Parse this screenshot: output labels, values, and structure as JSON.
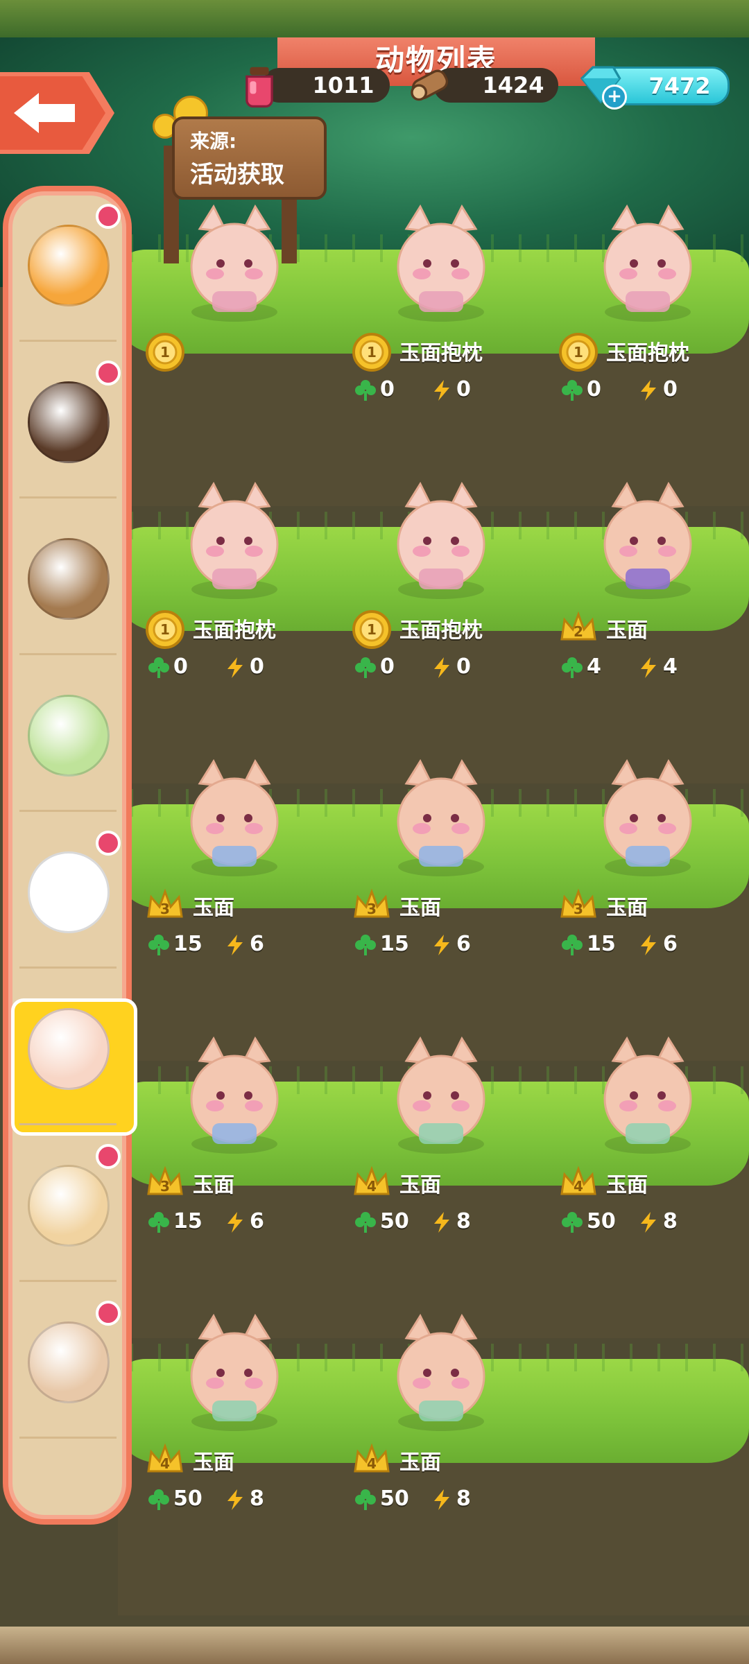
{
  "header": {
    "title": "动物列表",
    "currencies": [
      {
        "name": "potion",
        "icon": "potion-icon",
        "value": "1011"
      },
      {
        "name": "wood",
        "icon": "wood-log-icon",
        "value": "1424"
      },
      {
        "name": "gems",
        "icon": "gem-icon",
        "value": "7472"
      }
    ]
  },
  "source_sign": {
    "label": "来源:",
    "value": "活动获取"
  },
  "sidebar": {
    "items": [
      {
        "name": "cat",
        "color": "#f6a63b",
        "has_dot": true
      },
      {
        "name": "bear",
        "color": "#5a3b28",
        "has_dot": true
      },
      {
        "name": "potato",
        "color": "#a47a4f",
        "has_dot": false
      },
      {
        "name": "sheep",
        "color": "#bfe39a",
        "has_dot": false
      },
      {
        "name": "bunny",
        "color": "#ffffff",
        "has_dot": true
      },
      {
        "name": "fox-pillow",
        "color": "#f8d6c6",
        "has_dot": false,
        "selected": true
      },
      {
        "name": "hamster",
        "color": "#f1d3a0",
        "has_dot": true
      },
      {
        "name": "hedgehog",
        "color": "#e8c8a8",
        "has_dot": true
      }
    ]
  },
  "animals": [
    {
      "level": "1",
      "badge": "medal",
      "name": "",
      "clover": "",
      "energy": "",
      "variant": "pillow-top"
    },
    {
      "level": "1",
      "badge": "medal",
      "name": "玉面抱枕",
      "clover": "0",
      "energy": "0",
      "variant": "pillow"
    },
    {
      "level": "1",
      "badge": "medal",
      "name": "玉面抱枕",
      "clover": "0",
      "energy": "0",
      "variant": "pillow"
    },
    {
      "level": "1",
      "badge": "medal",
      "name": "玉面抱枕",
      "clover": "0",
      "energy": "0",
      "variant": "pillow"
    },
    {
      "level": "1",
      "badge": "medal",
      "name": "玉面抱枕",
      "clover": "0",
      "energy": "0",
      "variant": "pillow"
    },
    {
      "level": "2",
      "badge": "crown",
      "name": "玉面",
      "clover": "4",
      "energy": "4",
      "variant": "fox-purple"
    },
    {
      "level": "3",
      "badge": "crown",
      "name": "玉面",
      "clover": "15",
      "energy": "6",
      "variant": "fox-blue"
    },
    {
      "level": "3",
      "badge": "crown",
      "name": "玉面",
      "clover": "15",
      "energy": "6",
      "variant": "fox-blue"
    },
    {
      "level": "3",
      "badge": "crown",
      "name": "玉面",
      "clover": "15",
      "energy": "6",
      "variant": "fox-blue"
    },
    {
      "level": "3",
      "badge": "crown",
      "name": "玉面",
      "clover": "15",
      "energy": "6",
      "variant": "fox-blue"
    },
    {
      "level": "4",
      "badge": "crown",
      "name": "玉面",
      "clover": "50",
      "energy": "8",
      "variant": "fox-green"
    },
    {
      "level": "4",
      "badge": "crown",
      "name": "玉面",
      "clover": "50",
      "energy": "8",
      "variant": "fox-green"
    },
    {
      "level": "4",
      "badge": "crown",
      "name": "玉面",
      "clover": "50",
      "energy": "8",
      "variant": "fox-green"
    },
    {
      "level": "4",
      "badge": "crown",
      "name": "玉面",
      "clover": "50",
      "energy": "8",
      "variant": "fox-green"
    }
  ],
  "colors": {
    "clover": "#39b54a",
    "energy": "#f6b81c",
    "medal": "#f5c22a",
    "crown": "#f5c22a"
  }
}
